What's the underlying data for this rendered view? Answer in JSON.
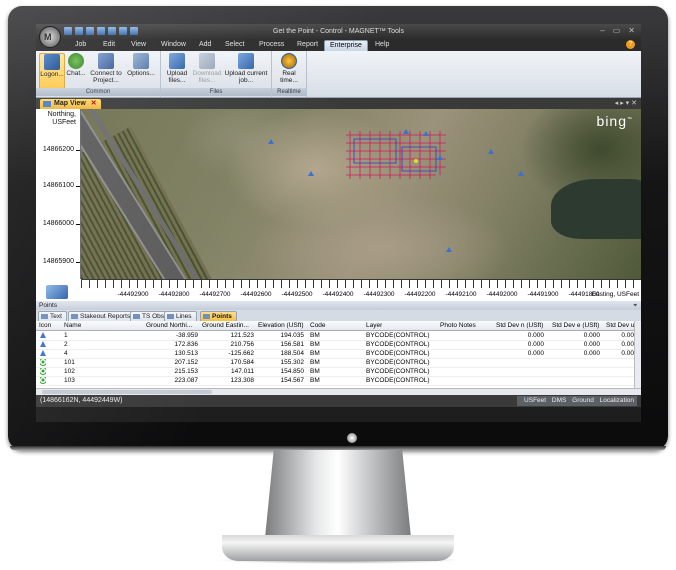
{
  "window": {
    "title": "Get the Point - Control - MAGNET™ Tools",
    "orb_label": "M",
    "min_glyph": "–",
    "max_glyph": "▭",
    "close_glyph": "✕",
    "help_glyph": "?"
  },
  "menu": [
    "Job",
    "Edit",
    "View",
    "Window",
    "Add",
    "Select",
    "Process",
    "Report",
    "Enterprise",
    "Help"
  ],
  "menu_active": "Enterprise",
  "ribbon": {
    "groups": [
      {
        "label": "Common",
        "buttons": [
          {
            "label": "Logon...",
            "icon": "logon-icon",
            "selected": true
          },
          {
            "label": "Chat...",
            "icon": "chat-icon"
          },
          {
            "label": "Connect to Project...",
            "icon": "connect-icon"
          },
          {
            "label": "Options...",
            "icon": "options-icon"
          }
        ]
      },
      {
        "label": "Files",
        "buttons": [
          {
            "label": "Upload files...",
            "icon": "upload-icon"
          },
          {
            "label": "Download files...",
            "icon": "download-icon",
            "disabled": true
          },
          {
            "label": "Upload current job...",
            "icon": "upload-job-icon"
          }
        ]
      },
      {
        "label": "Realtime",
        "buttons": [
          {
            "label": "Real time...",
            "icon": "realtime-icon"
          }
        ]
      }
    ]
  },
  "doc_tab": {
    "label": "Map View",
    "close": "✕"
  },
  "dock_controls": "◂ ▸ ▾ ✕",
  "map": {
    "y_title_line1": "Northing,",
    "y_title_line2": "USFeet",
    "y_ticks": [
      "14866200",
      "14866100",
      "14866000",
      "14865900"
    ],
    "x_ticks": [
      "-44492900",
      "-44492800",
      "-44492700",
      "-44492600",
      "-44492500",
      "-44492400",
      "-44492300",
      "-44492200",
      "-44492100",
      "-44492000",
      "-44491900",
      "-44491800"
    ],
    "x_title": "Easting, USFeet",
    "provider": "bing",
    "provider_tm": "™"
  },
  "points_panel": {
    "title": "Points",
    "pin": "⌖"
  },
  "tabs": [
    "Text",
    "Stakeout Reports",
    "TS Obs",
    "Lines",
    "Points"
  ],
  "tab_active": "Points",
  "table": {
    "columns": [
      "Icon",
      "Name",
      "Ground Northi...",
      "Ground Eastin...",
      "Elevation (USft)",
      "Code",
      "Layer",
      "Photo Notes",
      "Std Dev n (USft)",
      "Std Dev e (USft)",
      "Std Dev u (USft)"
    ],
    "rows": [
      {
        "icon": "triangle",
        "name": "1",
        "n": "-38.959",
        "e": "121.523",
        "elev": "194.035",
        "code": "BM",
        "layer": "BYCODE(CONTROL)",
        "sdn": "0.000",
        "sde": "0.000",
        "sdu": "0.00"
      },
      {
        "icon": "triangle",
        "name": "2",
        "n": "172.836",
        "e": "210.756",
        "elev": "156.581",
        "code": "BM",
        "layer": "BYCODE(CONTROL)",
        "sdn": "0.000",
        "sde": "0.000",
        "sdu": "0.00"
      },
      {
        "icon": "triangle",
        "name": "4",
        "n": "130.513",
        "e": "-125.662",
        "elev": "188.504",
        "code": "BM",
        "layer": "BYCODE(CONTROL)",
        "sdn": "0.000",
        "sde": "0.000",
        "sdu": "0.00"
      },
      {
        "icon": "circle",
        "name": "101",
        "n": "207.152",
        "e": "170.584",
        "elev": "155.302",
        "code": "BM",
        "layer": "BYCODE(CONTROL)",
        "sdn": "",
        "sde": "",
        "sdu": ""
      },
      {
        "icon": "circle",
        "name": "102",
        "n": "215.153",
        "e": "147.011",
        "elev": "154.850",
        "code": "BM",
        "layer": "BYCODE(CONTROL)",
        "sdn": "",
        "sde": "",
        "sdu": ""
      },
      {
        "icon": "circle",
        "name": "103",
        "n": "223.087",
        "e": "123.308",
        "elev": "154.567",
        "code": "BM",
        "layer": "BYCODE(CONTROL)",
        "sdn": "",
        "sde": "",
        "sdu": ""
      }
    ]
  },
  "status": {
    "coords": "(14866162N, 44492449W)",
    "units": [
      "USFeet",
      "DMS",
      "Ground",
      "Localization"
    ]
  },
  "colors": {
    "accent": "#f5be42",
    "triangle": "#3b6fd1",
    "circle": "#28a428"
  }
}
